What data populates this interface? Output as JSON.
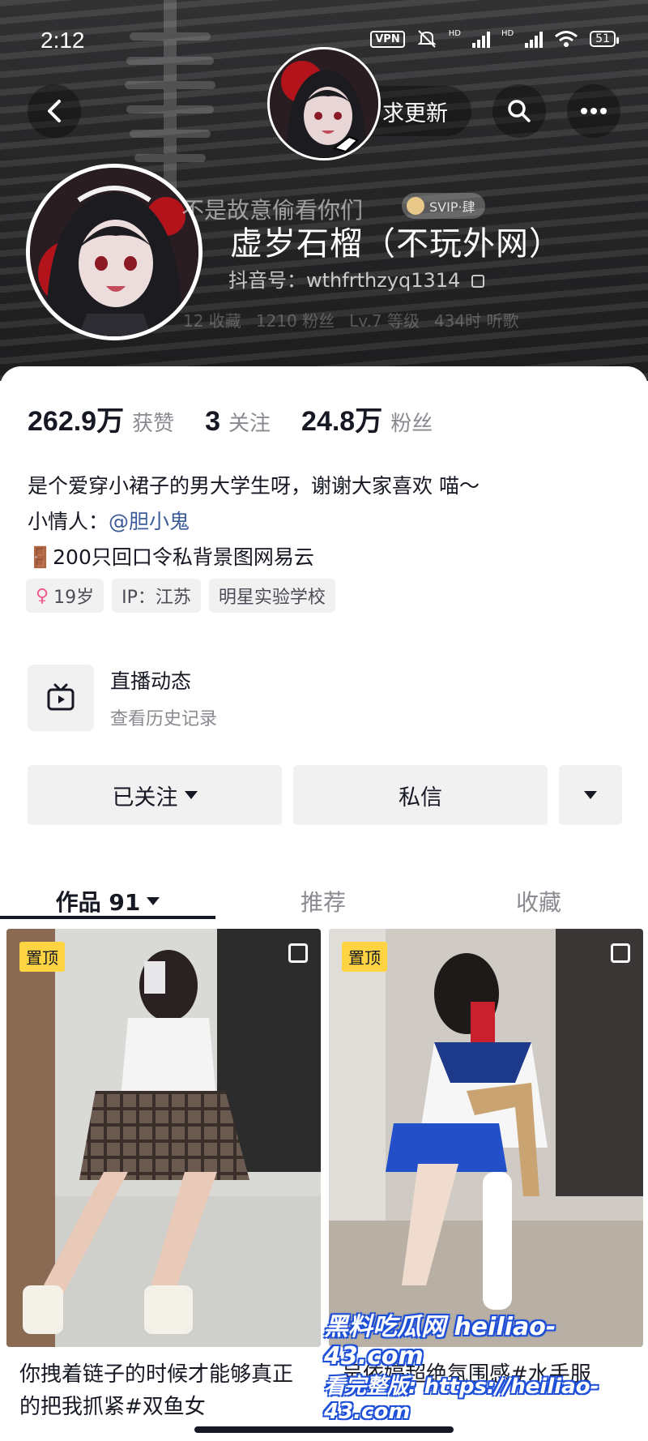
{
  "status_bar": {
    "time": "2:12",
    "vpn": "VPN",
    "hd1": "HD",
    "hd2": "HD",
    "battery": "51"
  },
  "header": {
    "update_label": "求更新",
    "ghost_text": "不是故意偷看你们",
    "svip": "SVIP·肆",
    "nickname": "虚岁石榴（不玩外网）",
    "douyin_id": "抖音号：wthfrthzyq1314",
    "dim_stats": [
      "12 收藏",
      "1210 粉丝",
      "Lv.7 等级",
      "434时 听歌"
    ]
  },
  "stats": [
    {
      "value": "262.9万",
      "label": "获赞"
    },
    {
      "value": "3",
      "label": "关注"
    },
    {
      "value": "24.8万",
      "label": "粉丝"
    }
  ],
  "bio": {
    "line1": "是个爱穿小裙子的男大学生呀，谢谢大家喜欢 喵～",
    "line2_prefix": "小情人：",
    "line2_mention": "@胆小鬼",
    "line3": "🚪200只回口令私背景图网易云"
  },
  "tags": {
    "age": "19岁",
    "ip": "IP：江苏",
    "school": "明星实验学校"
  },
  "live": {
    "title": "直播动态",
    "subtitle": "查看历史记录"
  },
  "actions": {
    "follow": "已关注",
    "message": "私信"
  },
  "tabs": {
    "works": "作品 91",
    "recommend": "推荐",
    "favorites": "收藏"
  },
  "videos": [
    {
      "pin": "置顶",
      "caption": "你拽着链子的时候才能够真正的把我抓紧#双鱼女"
    },
    {
      "pin": "置顶",
      "caption": "吴依婷超绝氛围感#水手服"
    }
  ],
  "watermark": {
    "line1": "黑料吃瓜网 heiliao-43.com",
    "line2": "看完整版: https://heiliao-43.com"
  }
}
